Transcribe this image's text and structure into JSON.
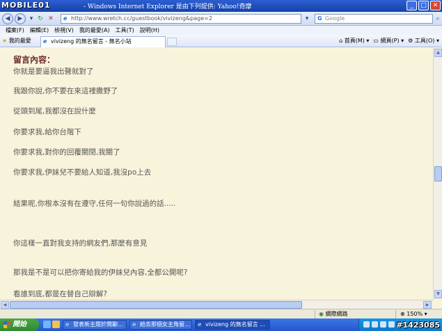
{
  "window": {
    "logo": "MOBILE01",
    "title": "- Windows Internet Explorer 是由下列提供: Yahoo!奇摩"
  },
  "address_bar": {
    "url": "http://www.wretch.cc/guestbook/vivizeng&page=2",
    "search_placeholder": "Google"
  },
  "menu": [
    "檔案(F)",
    "編輯(E)",
    "檢視(V)",
    "我的最愛(A)",
    "工具(T)",
    "說明(H)"
  ],
  "favorites_bar": {
    "favorites_label": "我的最愛",
    "tab_title": "vivizeng 的無名留言 - 無名小站",
    "commands": [
      "首頁(M)",
      "網頁(P)",
      "工具(O)"
    ]
  },
  "content": {
    "heading": "留言內容：",
    "lines": [
      "你就是要逼我出聲就對了",
      "我跟你說,你不要在來這裡撒野了",
      "從頭到尾,我都沒在說什麼",
      "你要求我,給你台階下",
      "你要求我,對你的回覆關閉,我關了",
      "你要求我,伊妹兒不要給人知道,我沒po上去",
      "結果呢,你根本沒有在遵守,任何一句你說過的話.....",
      "你這樣一直對我支持的網友們,那麼有意見",
      "那我是不是可以把你寄給我的伊妹兒內容,全都公開呢?",
      "看誰到底,都是在替自己辯解?"
    ]
  },
  "status_bar": {
    "zone": "網際網路",
    "zoom": "150%"
  },
  "taskbar": {
    "start_label": "開始",
    "tasks": [
      "發表新主題於鬧聊...",
      "給去那個女主角留...",
      "vivizeng 的無名留言 ..."
    ],
    "watermark": "#1423085"
  }
}
